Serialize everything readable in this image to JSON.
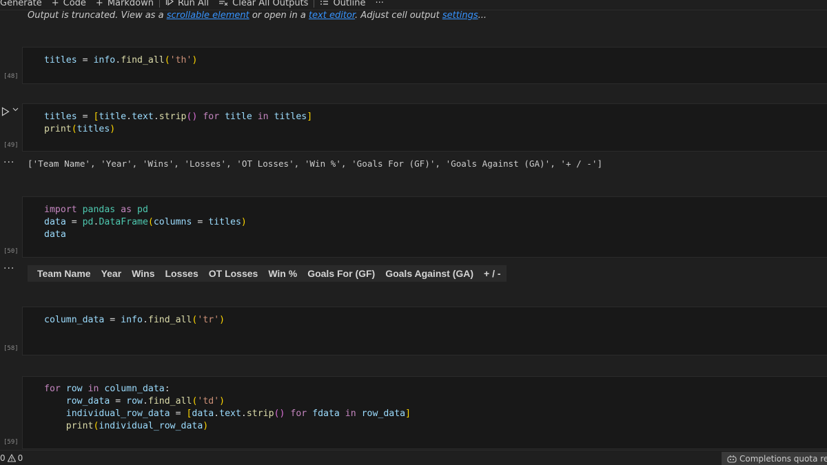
{
  "toolbar": {
    "generate": "Generate",
    "code": "Code",
    "markdown": "Markdown",
    "run_all": "Run All",
    "clear_outputs": "Clear All Outputs",
    "outline": "Outline",
    "more": "···"
  },
  "truncated": {
    "prefix": "Output is truncated. View as a ",
    "scrollable_link": "scrollable element",
    "middle": " or open in a ",
    "editor_link": "text editor",
    "suffix_a": ". Adjust cell output ",
    "settings_link": "settings",
    "suffix_b": "..."
  },
  "cells": [
    {
      "count": "[48]"
    },
    {
      "count": "[49]"
    },
    {
      "count": "[50]"
    },
    {
      "count": "[58]"
    },
    {
      "count": "[59]"
    }
  ],
  "outputs": {
    "cell49_text": "['Team Name', 'Year', 'Wins', 'Losses', 'OT Losses', 'Win %', 'Goals For (GF)', 'Goals Against (GA)', '+ / -']",
    "dataframe_columns": [
      "Team Name",
      "Year",
      "Wins",
      "Losses",
      "OT Losses",
      "Win %",
      "Goals For (GF)",
      "Goals Against (GA)",
      "+ / -"
    ]
  },
  "code": {
    "c48_l1": [
      "titles",
      " = ",
      "info",
      ".",
      "find_all",
      "(",
      "'th'",
      ")"
    ],
    "c49_l1": [
      "titles",
      " = ",
      "[",
      "title",
      ".",
      "text",
      ".",
      "strip",
      "()",
      " for ",
      "title",
      " in ",
      "titles",
      "]"
    ],
    "c49_l2": [
      "print",
      "(",
      "titles",
      ")"
    ],
    "c50_l1": [
      "import",
      " ",
      "pandas",
      " as ",
      "pd"
    ],
    "c50_l2": [
      "data",
      " = ",
      "pd",
      ".",
      "DataFrame",
      "(",
      "columns",
      " = ",
      "titles",
      ")"
    ],
    "c50_l3": [
      "data"
    ],
    "c58_l1": [
      "column_data",
      " = ",
      "info",
      ".",
      "find_all",
      "(",
      "'tr'",
      ")"
    ],
    "c59_l1": [
      "for",
      " ",
      "row",
      " in ",
      "column_data",
      ":"
    ],
    "c59_l2": [
      "    ",
      "row_data",
      " = ",
      "row",
      ".",
      "find_all",
      "(",
      "'td'",
      ")"
    ],
    "c59_l3": [
      "    ",
      "individual_row_data",
      " = ",
      "[",
      "data",
      ".",
      "text",
      ".",
      "strip",
      "()",
      " for ",
      "fdata",
      " in ",
      "row_data",
      "]"
    ],
    "c59_l4": [
      "    ",
      "print",
      "(",
      "individual_row_data",
      ")"
    ]
  },
  "status": {
    "errors": "0",
    "warnings": "0",
    "copilot": "Completions quota reached"
  },
  "icons": {
    "generate": "sparkle-icon",
    "code": "plus-icon",
    "markdown": "plus-icon",
    "run_all": "run-all-icon",
    "clear": "clear-all-icon",
    "outline": "list-icon",
    "warning": "warning-icon",
    "copilot": "copilot-icon"
  }
}
